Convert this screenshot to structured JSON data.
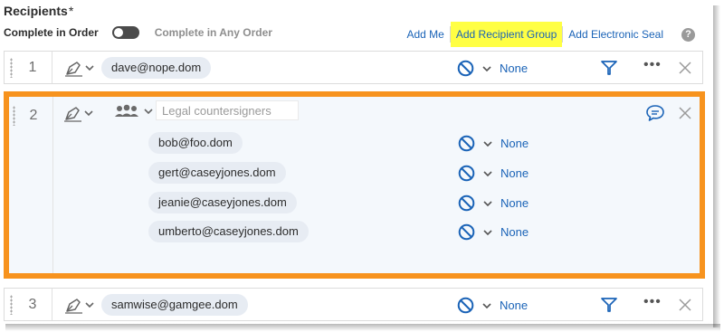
{
  "header": {
    "title": "Recipients",
    "required_mark": "*",
    "order_label": "Complete in Order",
    "order_alt_label": "Complete in Any Order"
  },
  "links": {
    "add_me": "Add Me",
    "add_group": "Add Recipient Group",
    "add_seal": "Add Electronic Seal",
    "help": "?"
  },
  "rows": {
    "r1": {
      "number": "1",
      "email": "dave@nope.dom",
      "auth": "None"
    },
    "r2": {
      "number": "2",
      "group_placeholder": "Legal countersigners",
      "members": [
        {
          "email": "bob@foo.dom",
          "auth": "None"
        },
        {
          "email": "gert@caseyjones.dom",
          "auth": "None"
        },
        {
          "email": "jeanie@caseyjones.dom",
          "auth": "None"
        },
        {
          "email": "umberto@caseyjones.dom",
          "auth": "None"
        }
      ]
    },
    "r3": {
      "number": "3",
      "email": "samwise@gamgee.dom",
      "auth": "None"
    }
  },
  "colors": {
    "accent_blue": "#1a63b7",
    "highlight_yellow": "#ffff44",
    "group_border": "#f7931e"
  },
  "icons": {
    "role": "pen-signer-icon",
    "auth": "no-auth-icon",
    "group": "people-group-icon",
    "filter": "filter-icon",
    "more": "more-options-icon",
    "close": "close-icon",
    "message": "message-icon"
  }
}
